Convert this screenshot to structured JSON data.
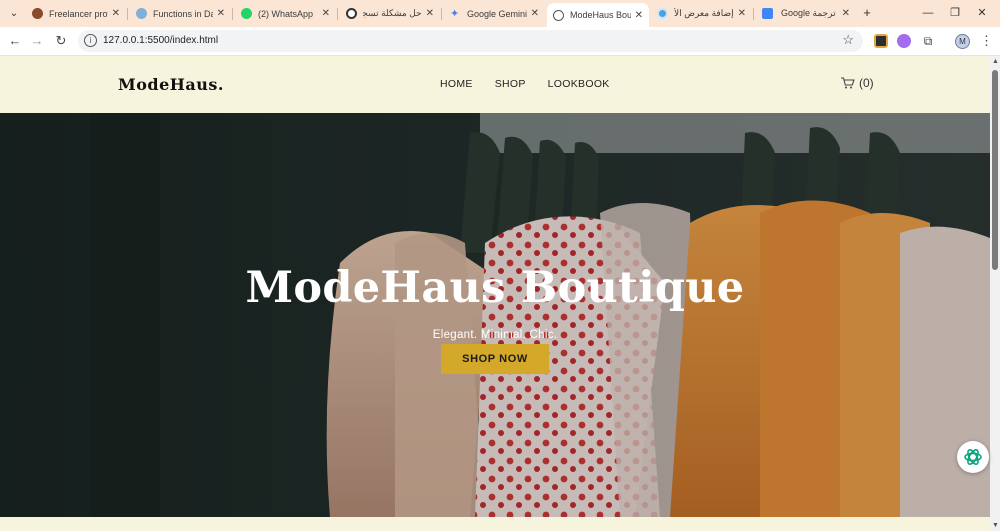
{
  "browser": {
    "tabs": [
      {
        "title": "Freelancer profil",
        "favicon_color": "#8a4b2a"
      },
      {
        "title": "Functions in Dar",
        "favicon_color": "#7fb0d8"
      },
      {
        "title": "(2) WhatsApp",
        "favicon_color": "#25d366"
      },
      {
        "title": "حل مشكلة تسجيل",
        "favicon_color": "#333333"
      },
      {
        "title": "Google Gemini",
        "favicon_color": "#4c7df0"
      },
      {
        "title": "ModeHaus Bouti",
        "favicon_color": "#555555"
      },
      {
        "title": "إضافة معرض الأ",
        "favicon_color": "#4aa3df"
      },
      {
        "title": "Google ترجمة",
        "favicon_color": "#4285f4"
      }
    ],
    "active_tab": 5,
    "close_glyph": "✕",
    "new_tab_glyph": "+",
    "url": "127.0.0.1:5500/index.html",
    "profile_initial": "M"
  },
  "site": {
    "logo": "ModeHaus.",
    "nav": [
      "HOME",
      "SHOP",
      "LOOKBOOK"
    ],
    "cart_label": "(0)",
    "hero_title": "ModeHaus Boutique",
    "hero_subtitle": "Elegant. Minimal. Chic.",
    "hero_cta": "SHOP NOW"
  },
  "colors": {
    "header_bg": "#f6f4dc",
    "accent": "#d4a92a",
    "tabbar_bg": "#fbe6d5"
  }
}
